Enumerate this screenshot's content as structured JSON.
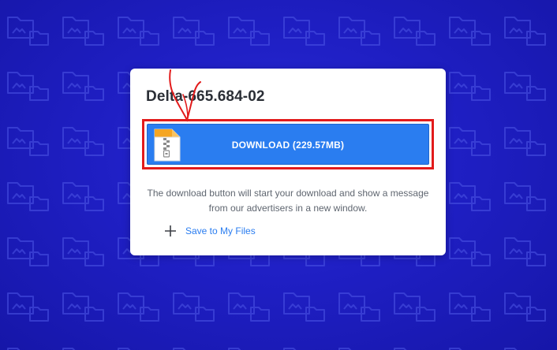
{
  "file": {
    "title": "Delta-665.684-02"
  },
  "download": {
    "label": "DOWNLOAD (229.57MB)",
    "icon": "zip-file-icon"
  },
  "notice": {
    "line1": "The download button will start your download and show a message",
    "line2": "from our advertisers in a new window."
  },
  "save": {
    "icon": "plus-icon",
    "label": "Save to My Files"
  },
  "colors": {
    "background": "#1f1fc4",
    "accent": "#2a7df0",
    "highlight_outline": "#e21b1b",
    "card": "#ffffff"
  }
}
